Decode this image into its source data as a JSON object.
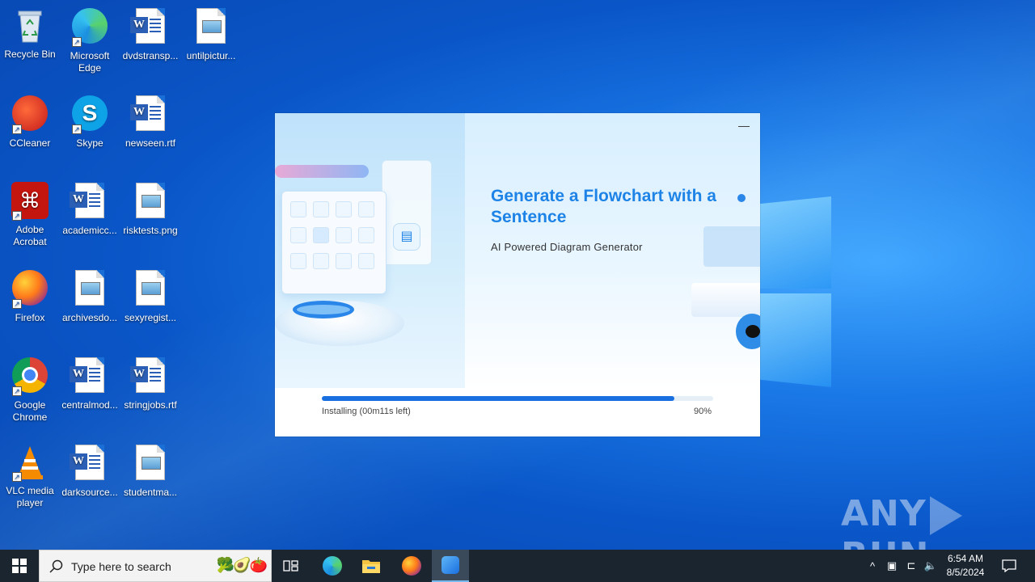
{
  "desktop": {
    "icons": [
      {
        "label": "Recycle Bin",
        "icon": "recycle-bin-icon"
      },
      {
        "label": "Microsoft Edge",
        "icon": "edge-icon"
      },
      {
        "label": "dvdstransp...",
        "icon": "word-doc-icon"
      },
      {
        "label": "untilpictur...",
        "icon": "image-file-icon"
      },
      {
        "label": "CCleaner",
        "icon": "ccleaner-icon"
      },
      {
        "label": "Skype",
        "icon": "skype-icon"
      },
      {
        "label": "newseen.rtf",
        "icon": "word-doc-icon"
      },
      {
        "label": "Adobe Acrobat",
        "icon": "acrobat-icon"
      },
      {
        "label": "academicc...",
        "icon": "word-doc-icon"
      },
      {
        "label": "risktests.png",
        "icon": "image-file-icon"
      },
      {
        "label": "Firefox",
        "icon": "firefox-icon"
      },
      {
        "label": "archivesdo...",
        "icon": "image-file-icon"
      },
      {
        "label": "sexyregist...",
        "icon": "image-file-icon"
      },
      {
        "label": "Google Chrome",
        "icon": "chrome-icon"
      },
      {
        "label": "centralmod...",
        "icon": "word-doc-icon"
      },
      {
        "label": "stringjobs.rtf",
        "icon": "word-doc-icon"
      },
      {
        "label": "VLC media player",
        "icon": "vlc-icon"
      },
      {
        "label": "darksource...",
        "icon": "word-doc-icon"
      },
      {
        "label": "studentma...",
        "icon": "image-file-icon"
      }
    ]
  },
  "installer": {
    "minimize_label": "—",
    "title": "Generate a Flowchart with a Sentence",
    "subtitle": "AI Powered Diagram Generator",
    "status": "Installing (00m11s left)",
    "percent_label": "90%",
    "progress": 0.9,
    "accent_color": "#1a6fe0"
  },
  "taskbar": {
    "search_placeholder": "Type here to search",
    "search_decor": "🥦🥑🍅",
    "apps": [
      "task-view",
      "edge",
      "file-explorer",
      "firefox",
      "installer"
    ],
    "clock_time": "6:54 AM",
    "clock_date": "8/5/2024"
  },
  "watermark": {
    "left": "ANY",
    "right": "RUN"
  }
}
